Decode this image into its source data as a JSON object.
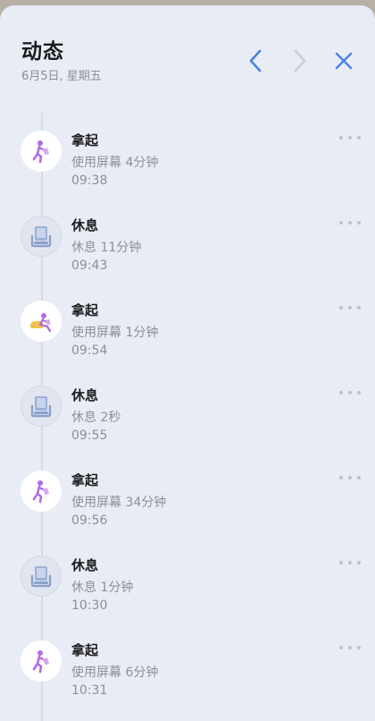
{
  "header": {
    "title": "动态",
    "date": "6月5日, 星期五"
  },
  "colors": {
    "accent": "#4a82e8",
    "disabled": "#c9cfdb",
    "background": "#e8ecf5"
  },
  "icons": {
    "prev": "chevron-left-icon",
    "next": "chevron-right-icon",
    "close": "close-icon",
    "pickup": "pickup-person-icon",
    "rest": "rest-phone-icon",
    "more": "more-icon"
  },
  "entries": [
    {
      "type": "pickup",
      "title": "拿起",
      "detail": "使用屏幕 4分钟",
      "time": "09:38"
    },
    {
      "type": "rest",
      "title": "休息",
      "detail": "休息 11分钟",
      "time": "09:43"
    },
    {
      "type": "pickup-sit",
      "title": "拿起",
      "detail": "使用屏幕 1分钟",
      "time": "09:54"
    },
    {
      "type": "rest",
      "title": "休息",
      "detail": "休息 2秒",
      "time": "09:55"
    },
    {
      "type": "pickup",
      "title": "拿起",
      "detail": "使用屏幕 34分钟",
      "time": "09:56"
    },
    {
      "type": "rest",
      "title": "休息",
      "detail": "休息 1分钟",
      "time": "10:30"
    },
    {
      "type": "pickup",
      "title": "拿起",
      "detail": "使用屏幕 6分钟",
      "time": "10:31"
    }
  ]
}
